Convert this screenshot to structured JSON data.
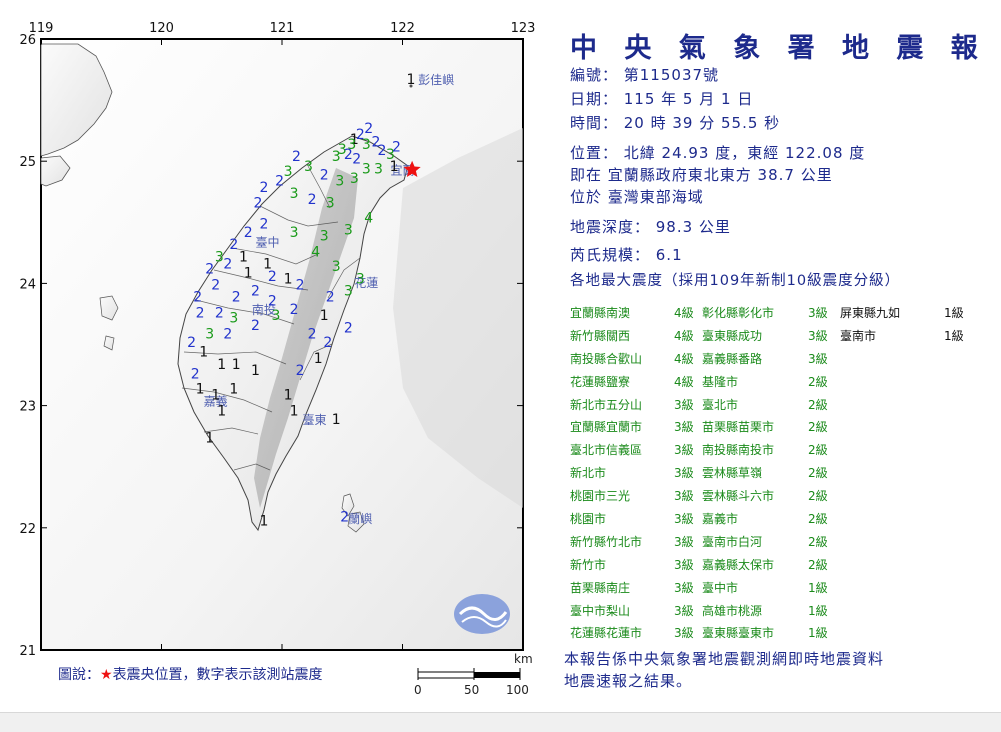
{
  "title": "中 央 氣 象 署 地 震 報 告",
  "report": {
    "number": "編號： 第115037號",
    "date": "日期： 115 年 5 月 1 日",
    "time": "時間： 20 時 39 分 55.5 秒",
    "location": "位置： 北緯 24.93 度，東經 122.08 度",
    "location_ref": "即在 宜蘭縣政府東北東方 38.7 公里",
    "location_area": "位於 臺灣東部海域",
    "depth": "地震深度： 98.3 公里",
    "magnitude": "芮氏規模： 6.1",
    "intensity_header": "各地最大震度（採用109年新制10級震度分級）",
    "note_line1": "本報告係中央氣象署地震觀測網即時地震資料",
    "note_line2": "地震速報之結果。"
  },
  "intensities": [
    {
      "station": "宜蘭縣南澳",
      "level": "4級"
    },
    {
      "station": "新竹縣關西",
      "level": "4級"
    },
    {
      "station": "南投縣合歡山",
      "level": "4級"
    },
    {
      "station": "花蓮縣鹽寮",
      "level": "4級"
    },
    {
      "station": "新北市五分山",
      "level": "3級"
    },
    {
      "station": "宜蘭縣宜蘭市",
      "level": "3級"
    },
    {
      "station": "臺北市信義區",
      "level": "3級"
    },
    {
      "station": "新北市",
      "level": "3級"
    },
    {
      "station": "桃園市三光",
      "level": "3級"
    },
    {
      "station": "桃園市",
      "level": "3級"
    },
    {
      "station": "新竹縣竹北市",
      "level": "3級"
    },
    {
      "station": "新竹市",
      "level": "3級"
    },
    {
      "station": "苗栗縣南庄",
      "level": "3級"
    },
    {
      "station": "臺中市梨山",
      "level": "3級"
    },
    {
      "station": "花蓮縣花蓮市",
      "level": "3級"
    },
    {
      "station": "彰化縣彰化市",
      "level": "3級"
    },
    {
      "station": "臺東縣成功",
      "level": "3級"
    },
    {
      "station": "嘉義縣番路",
      "level": "3級"
    },
    {
      "station": "基隆市",
      "level": "2級"
    },
    {
      "station": "臺北市",
      "level": "2級"
    },
    {
      "station": "苗栗縣苗栗市",
      "level": "2級"
    },
    {
      "station": "南投縣南投市",
      "level": "2級"
    },
    {
      "station": "雲林縣草嶺",
      "level": "2級"
    },
    {
      "station": "雲林縣斗六市",
      "level": "2級"
    },
    {
      "station": "嘉義市",
      "level": "2級"
    },
    {
      "station": "臺南市白河",
      "level": "2級"
    },
    {
      "station": "嘉義縣太保市",
      "level": "2級"
    },
    {
      "station": "臺中市",
      "level": "1級"
    },
    {
      "station": "高雄市桃源",
      "level": "1級"
    },
    {
      "station": "臺東縣臺東市",
      "level": "1級"
    },
    {
      "station": "屏東縣九如",
      "level": "1級"
    },
    {
      "station": "臺南市",
      "level": "1級"
    }
  ],
  "map": {
    "lon_ticks": [
      "119",
      "120",
      "121",
      "122",
      "123"
    ],
    "lat_ticks": [
      "26",
      "25",
      "24",
      "23",
      "22",
      "21"
    ],
    "place_labels": [
      "彭佳嶼",
      "宜蘭",
      "臺中",
      "花蓮",
      "南投",
      "嘉義",
      "臺東",
      "蘭嶼"
    ],
    "legend": "圖說：★表震央位置，數字表示該測站震度",
    "scale_unit": "km",
    "scale_ticks": [
      "0",
      "50",
      "100"
    ],
    "epicenter": {
      "lon": 122.08,
      "lat": 24.93
    },
    "stations": [
      {
        "v": "1",
        "lon": 122.07,
        "lat": 25.63
      },
      {
        "v": "2",
        "lon": 121.72,
        "lat": 25.23
      },
      {
        "v": "2",
        "lon": 121.65,
        "lat": 25.18
      },
      {
        "v": "1",
        "lon": 121.6,
        "lat": 25.14
      },
      {
        "v": "2",
        "lon": 121.78,
        "lat": 25.12
      },
      {
        "v": "3",
        "lon": 121.7,
        "lat": 25.1
      },
      {
        "v": "3",
        "lon": 121.58,
        "lat": 25.1
      },
      {
        "v": "3",
        "lon": 121.5,
        "lat": 25.06
      },
      {
        "v": "2",
        "lon": 121.55,
        "lat": 25.02
      },
      {
        "v": "3",
        "lon": 121.45,
        "lat": 25.0
      },
      {
        "v": "2",
        "lon": 121.62,
        "lat": 24.98
      },
      {
        "v": "2",
        "lon": 121.83,
        "lat": 25.05
      },
      {
        "v": "3",
        "lon": 121.9,
        "lat": 25.02
      },
      {
        "v": "2",
        "lon": 121.95,
        "lat": 25.08
      },
      {
        "v": "1",
        "lon": 121.93,
        "lat": 24.92
      },
      {
        "v": "3",
        "lon": 121.8,
        "lat": 24.9
      },
      {
        "v": "3",
        "lon": 121.7,
        "lat": 24.9
      },
      {
        "v": "3",
        "lon": 121.6,
        "lat": 24.82
      },
      {
        "v": "3",
        "lon": 121.48,
        "lat": 24.8
      },
      {
        "v": "2",
        "lon": 121.35,
        "lat": 24.85
      },
      {
        "v": "3",
        "lon": 121.22,
        "lat": 24.92
      },
      {
        "v": "2",
        "lon": 121.12,
        "lat": 25.0
      },
      {
        "v": "3",
        "lon": 121.05,
        "lat": 24.88
      },
      {
        "v": "2",
        "lon": 120.98,
        "lat": 24.8
      },
      {
        "v": "2",
        "lon": 120.85,
        "lat": 24.75
      },
      {
        "v": "2",
        "lon": 120.8,
        "lat": 24.62
      },
      {
        "v": "3",
        "lon": 121.1,
        "lat": 24.7
      },
      {
        "v": "2",
        "lon": 121.25,
        "lat": 24.65
      },
      {
        "v": "3",
        "lon": 121.4,
        "lat": 24.62
      },
      {
        "v": "4",
        "lon": 121.72,
        "lat": 24.5
      },
      {
        "v": "3",
        "lon": 121.55,
        "lat": 24.4
      },
      {
        "v": "3",
        "lon": 121.35,
        "lat": 24.35
      },
      {
        "v": "4",
        "lon": 121.28,
        "lat": 24.22
      },
      {
        "v": "3",
        "lon": 121.1,
        "lat": 24.38
      },
      {
        "v": "2",
        "lon": 120.85,
        "lat": 24.45
      },
      {
        "v": "2",
        "lon": 120.72,
        "lat": 24.38
      },
      {
        "v": "2",
        "lon": 120.6,
        "lat": 24.28
      },
      {
        "v": "1",
        "lon": 120.68,
        "lat": 24.18
      },
      {
        "v": "2",
        "lon": 120.55,
        "lat": 24.12
      },
      {
        "v": "3",
        "lon": 120.48,
        "lat": 24.18
      },
      {
        "v": "2",
        "lon": 120.4,
        "lat": 24.08
      },
      {
        "v": "1",
        "lon": 120.72,
        "lat": 24.05
      },
      {
        "v": "1",
        "lon": 120.88,
        "lat": 24.12
      },
      {
        "v": "2",
        "lon": 120.92,
        "lat": 24.02
      },
      {
        "v": "1",
        "lon": 121.05,
        "lat": 24.0
      },
      {
        "v": "3",
        "lon": 121.65,
        "lat": 24.0
      },
      {
        "v": "3",
        "lon": 121.55,
        "lat": 23.9
      },
      {
        "v": "2",
        "lon": 121.4,
        "lat": 23.85
      },
      {
        "v": "2",
        "lon": 121.15,
        "lat": 23.95
      },
      {
        "v": "2",
        "lon": 120.92,
        "lat": 23.82
      },
      {
        "v": "2",
        "lon": 120.78,
        "lat": 23.9
      },
      {
        "v": "2",
        "lon": 120.62,
        "lat": 23.85
      },
      {
        "v": "2",
        "lon": 120.45,
        "lat": 23.95
      },
      {
        "v": "2",
        "lon": 120.3,
        "lat": 23.85
      },
      {
        "v": "2",
        "lon": 120.32,
        "lat": 23.72
      },
      {
        "v": "2",
        "lon": 120.48,
        "lat": 23.72
      },
      {
        "v": "3",
        "lon": 120.6,
        "lat": 23.68
      },
      {
        "v": "2",
        "lon": 120.78,
        "lat": 23.62
      },
      {
        "v": "3",
        "lon": 120.95,
        "lat": 23.7
      },
      {
        "v": "2",
        "lon": 120.55,
        "lat": 23.55
      },
      {
        "v": "3",
        "lon": 120.4,
        "lat": 23.55
      },
      {
        "v": "2",
        "lon": 120.25,
        "lat": 23.48
      },
      {
        "v": "1",
        "lon": 120.35,
        "lat": 23.4
      },
      {
        "v": "1",
        "lon": 120.5,
        "lat": 23.3
      },
      {
        "v": "1",
        "lon": 120.62,
        "lat": 23.3
      },
      {
        "v": "1",
        "lon": 120.78,
        "lat": 23.25
      },
      {
        "v": "2",
        "lon": 120.28,
        "lat": 23.22
      },
      {
        "v": "1",
        "lon": 120.32,
        "lat": 23.1
      },
      {
        "v": "1",
        "lon": 120.45,
        "lat": 23.05
      },
      {
        "v": "1",
        "lon": 120.6,
        "lat": 23.1
      },
      {
        "v": "1",
        "lon": 120.5,
        "lat": 22.92
      },
      {
        "v": "1",
        "lon": 120.4,
        "lat": 22.7
      },
      {
        "v": "2",
        "lon": 121.1,
        "lat": 23.75
      },
      {
        "v": "2",
        "lon": 121.25,
        "lat": 23.55
      },
      {
        "v": "2",
        "lon": 121.38,
        "lat": 23.48
      },
      {
        "v": "1",
        "lon": 121.3,
        "lat": 23.35
      },
      {
        "v": "2",
        "lon": 121.15,
        "lat": 23.25
      },
      {
        "v": "1",
        "lon": 121.05,
        "lat": 23.05
      },
      {
        "v": "1",
        "lon": 121.1,
        "lat": 22.92
      },
      {
        "v": "1",
        "lon": 121.45,
        "lat": 22.85
      },
      {
        "v": "1",
        "lon": 120.85,
        "lat": 22.02
      },
      {
        "v": "2",
        "lon": 121.52,
        "lat": 22.05
      },
      {
        "v": "3",
        "lon": 121.45,
        "lat": 24.1
      },
      {
        "v": "2",
        "lon": 121.55,
        "lat": 23.6
      },
      {
        "v": "1",
        "lon": 121.35,
        "lat": 23.7
      }
    ]
  }
}
